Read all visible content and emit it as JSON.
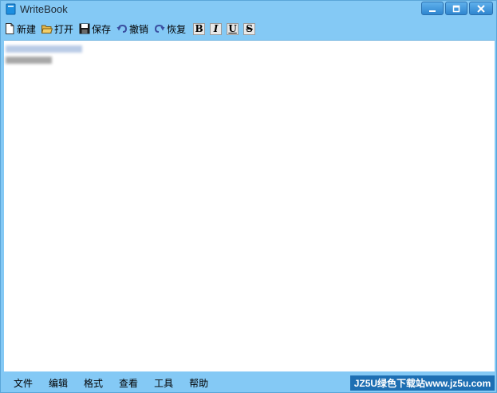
{
  "window": {
    "title": "WriteBook"
  },
  "toolbar": {
    "new_label": "新建",
    "open_label": "打开",
    "save_label": "保存",
    "undo_label": "撤销",
    "redo_label": "恢复",
    "bold": "B",
    "italic": "I",
    "underline": "U",
    "strike": "S"
  },
  "menu": [
    "文件",
    "编辑",
    "格式",
    "查看",
    "工具",
    "帮助"
  ],
  "watermark": "JZ5U绿色下载站www.jz5u.com",
  "colors": {
    "chrome": "#84c9f5",
    "editor_bg": "#ffffff",
    "watermark_bg": "#1e6fb3"
  }
}
